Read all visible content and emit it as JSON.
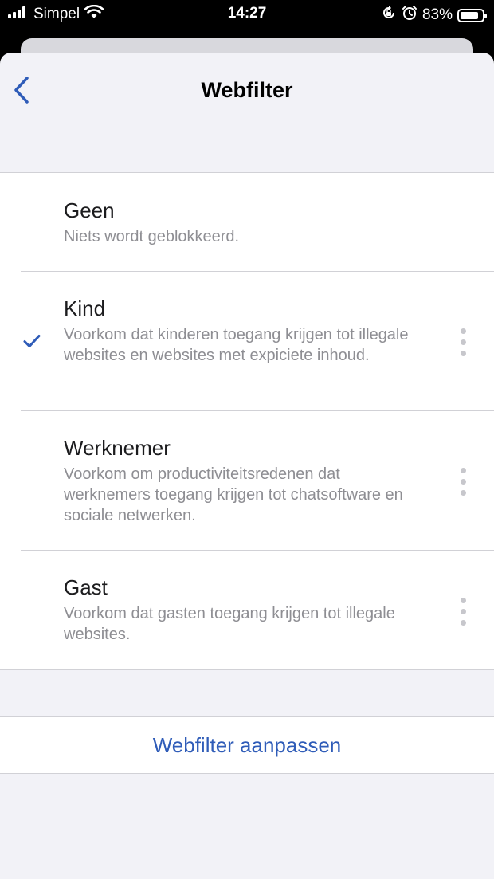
{
  "status_bar": {
    "carrier": "Simpel",
    "time": "14:27",
    "battery_percent": "83%",
    "battery_level": 0.83
  },
  "nav": {
    "title": "Webfilter",
    "back_icon": "chevron-left-icon"
  },
  "filters": [
    {
      "title": "Geen",
      "description": "Niets wordt geblokkeerd.",
      "selected": false,
      "has_menu": false
    },
    {
      "title": "Kind",
      "description": "Voorkom dat kinderen toegang krijgen tot illegale websites en websites met expiciete inhoud.",
      "selected": true,
      "has_menu": true
    },
    {
      "title": "Werknemer",
      "description": "Voorkom om productiviteitsredenen dat werknemers toegang krijgen tot chatsoftware en sociale netwerken.",
      "selected": false,
      "has_menu": true
    },
    {
      "title": "Gast",
      "description": "Voorkom dat gasten toegang krijgen tot illegale websites.",
      "selected": false,
      "has_menu": true
    }
  ],
  "action": {
    "label": "Webfilter aanpassen"
  },
  "colors": {
    "accent": "#2f5cb8",
    "background": "#f2f2f7"
  }
}
